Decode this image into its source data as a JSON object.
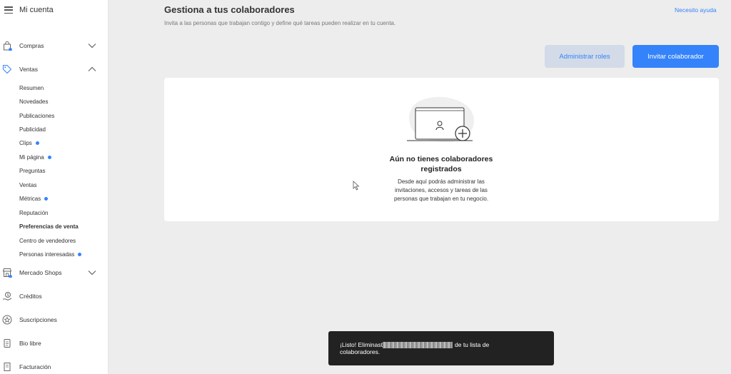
{
  "sidebar": {
    "title": "Mi cuenta",
    "compras": {
      "label": "Compras"
    },
    "ventas": {
      "label": "Ventas",
      "items": [
        {
          "label": "Resumen",
          "dot": false,
          "active": false
        },
        {
          "label": "Novedades",
          "dot": false,
          "active": false
        },
        {
          "label": "Publicaciones",
          "dot": false,
          "active": false
        },
        {
          "label": "Publicidad",
          "dot": false,
          "active": false
        },
        {
          "label": "Clips",
          "dot": true,
          "active": false
        },
        {
          "label": "Mi página",
          "dot": true,
          "active": false
        },
        {
          "label": "Preguntas",
          "dot": false,
          "active": false
        },
        {
          "label": "Ventas",
          "dot": false,
          "active": false
        },
        {
          "label": "Métricas",
          "dot": true,
          "active": false
        },
        {
          "label": "Reputación",
          "dot": false,
          "active": false
        },
        {
          "label": "Preferencias de venta",
          "dot": false,
          "active": true
        },
        {
          "label": "Centro de vendedores",
          "dot": false,
          "active": false
        },
        {
          "label": "Personas interesadas",
          "dot": true,
          "active": false
        }
      ]
    },
    "mercado_shops": {
      "label": "Mercado Shops"
    },
    "creditos": {
      "label": "Créditos"
    },
    "suscripciones": {
      "label": "Suscripciones"
    },
    "bio_libre": {
      "label": "Bio libre"
    },
    "facturacion": {
      "label": "Facturación"
    }
  },
  "header": {
    "title": "Gestiona a tus colaboradores",
    "subtitle": "Invita a las personas que trabajan contigo y define qué tareas pueden realizar en tu cuenta.",
    "help_link": "Necesito ayuda"
  },
  "actions": {
    "roles_label": "Administrar roles",
    "invite_label": "Invitar colaborador"
  },
  "empty_state": {
    "title_line1": "Aún no tienes colaboradores",
    "title_line2": "registrados",
    "desc_line1": "Desde aquí podrás administrar las",
    "desc_line2": "invitaciones, accesos y tareas de las",
    "desc_line3": "personas que trabajan en tu negocio."
  },
  "toast": {
    "text_before": "¡Listo! Eliminast",
    "text_after": "de tu lista de",
    "text_line2": "colaboradores."
  },
  "colors": {
    "accent": "#3483fa",
    "roles_button_bg": "#d2dbe7",
    "toast_bg": "#222222",
    "page_bg": "#ededed"
  }
}
